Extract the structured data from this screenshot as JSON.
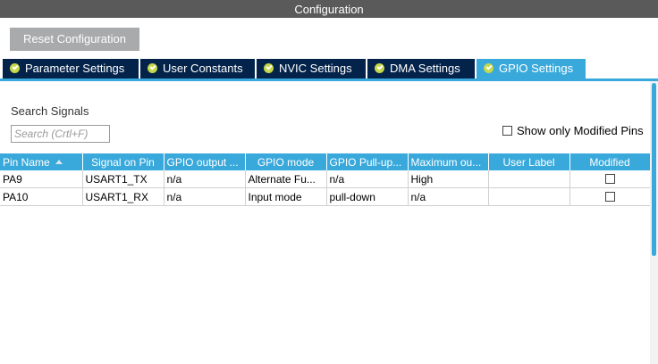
{
  "window": {
    "title": "Configuration"
  },
  "toolbar": {
    "reset_label": "Reset Configuration"
  },
  "tabs": [
    {
      "label": "Parameter Settings",
      "active": false
    },
    {
      "label": "User Constants",
      "active": false
    },
    {
      "label": "NVIC Settings",
      "active": false
    },
    {
      "label": "DMA Settings",
      "active": false
    },
    {
      "label": "GPIO Settings",
      "active": true
    }
  ],
  "search": {
    "label": "Search Signals",
    "placeholder": "Search (Crtl+F)",
    "value": ""
  },
  "filter": {
    "show_modified_label": "Show only Modified Pins",
    "checked": false
  },
  "table": {
    "columns": [
      "Pin Name",
      "Signal on Pin",
      "GPIO output ...",
      "GPIO mode",
      "GPIO Pull-up...",
      "Maximum ou...",
      "User Label",
      "Modified"
    ],
    "sort": {
      "column": "Pin Name",
      "direction": "ascending"
    },
    "rows": [
      {
        "pin": "PA9",
        "signal": "USART1_TX",
        "output": "n/a",
        "mode": "Alternate Fu...",
        "pull": "n/a",
        "max": "High",
        "label": "",
        "modified": false
      },
      {
        "pin": "PA10",
        "signal": "USART1_RX",
        "output": "n/a",
        "mode": "Input mode",
        "pull": "pull-down",
        "max": "n/a",
        "label": "",
        "modified": false
      }
    ]
  },
  "colors": {
    "accent": "#39a9dc",
    "tab_inactive": "#03234b",
    "check_badge": "#c6d84a",
    "titlebar": "#5a5a5a",
    "button": "#a9aaac"
  },
  "icons": {
    "tab_status": "check-circle-icon",
    "sort": "sort-ascending-icon",
    "checkbox": "checkbox-icon"
  }
}
